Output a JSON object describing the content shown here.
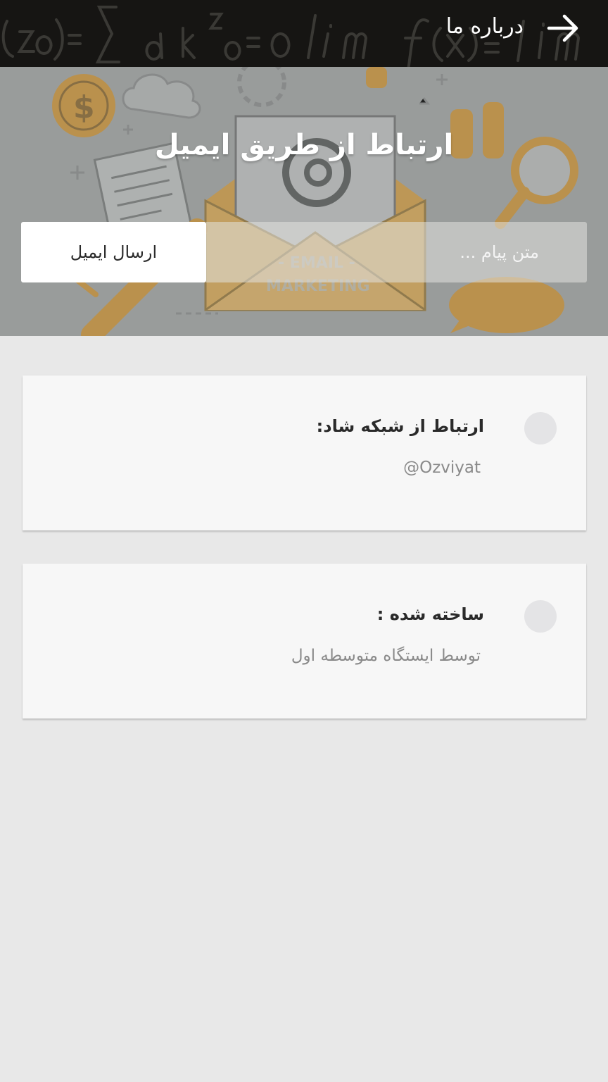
{
  "appbar": {
    "title": "درباره ما",
    "back_icon": "arrow-right-icon",
    "background": "#161513"
  },
  "hero": {
    "heading": "ارتباط از طریق ایمیل",
    "send_button_label": "ارسال ایمیل",
    "message_placeholder": "متن پیام ...",
    "message_value": "",
    "illustration_text": "EMAIL MARKETING",
    "accent": "#e8a23a"
  },
  "cards": [
    {
      "label": "ارتباط از شبکه شاد:",
      "value": "@Ozviyat",
      "icon": "circle-icon"
    },
    {
      "label": "ساخته شده :",
      "value": "توسط ایستگاه متوسطه اول",
      "icon": "circle-icon"
    }
  ]
}
